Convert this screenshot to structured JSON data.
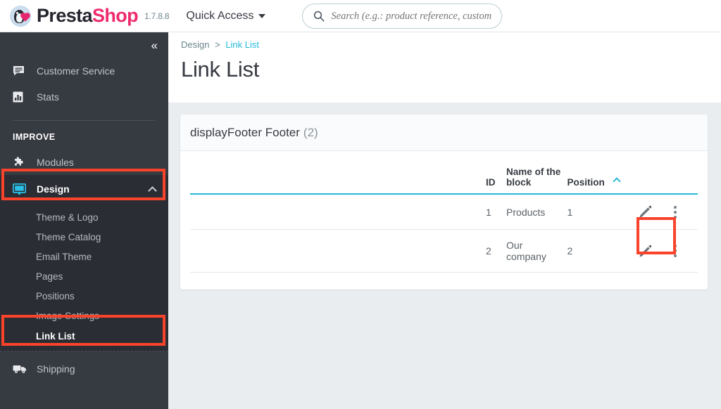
{
  "header": {
    "brand_part1": "Presta",
    "brand_part2": "Shop",
    "version": "1.7.8.8",
    "quick_access_label": "Quick Access",
    "search_placeholder": "Search (e.g.: product reference, custom",
    "search_value": "",
    "logo_icon": "prestashop-logo-icon",
    "search_icon": "search-icon",
    "caret_icon": "chevron-down-icon"
  },
  "sidebar": {
    "collapse_icon": "double-chevron-left-icon",
    "collapse_glyph": "«",
    "top_items": [
      {
        "label": "Customer Service",
        "icon": "comment-icon"
      },
      {
        "label": "Stats",
        "icon": "bar-chart-icon"
      }
    ],
    "section_title": "IMPROVE",
    "items": [
      {
        "label": "Modules",
        "icon": "puzzle-piece-icon"
      },
      {
        "label": "Design",
        "icon": "desktop-icon",
        "active": true,
        "chevron": "chevron-up-icon"
      }
    ],
    "submenu": [
      {
        "label": "Theme & Logo"
      },
      {
        "label": "Theme Catalog"
      },
      {
        "label": "Email Theme"
      },
      {
        "label": "Pages"
      },
      {
        "label": "Positions"
      },
      {
        "label": "Image Settings"
      },
      {
        "label": "Link List",
        "current": true
      }
    ],
    "bottom_items": [
      {
        "label": "Shipping",
        "icon": "truck-icon"
      }
    ]
  },
  "breadcrumb": {
    "parent": "Design",
    "separator": ">",
    "current": "Link List"
  },
  "page": {
    "title": "Link List"
  },
  "card": {
    "title": "displayFooter Footer",
    "count": "(2)"
  },
  "table": {
    "columns": [
      {
        "key": "id",
        "label": "ID"
      },
      {
        "key": "name",
        "label": "Name of the block"
      },
      {
        "key": "position",
        "label": "Position",
        "sorted": "asc",
        "sort_icon": "chevron-up-icon"
      },
      {
        "key": "actions",
        "label": ""
      }
    ],
    "rows": [
      {
        "id": "1",
        "name": "Products",
        "position": "1",
        "edit_icon": "pencil-icon",
        "menu_icon": "kebab-menu-icon",
        "highlighted": true
      },
      {
        "id": "2",
        "name": "Our company",
        "position": "2",
        "edit_icon": "pencil-icon",
        "menu_icon": "kebab-menu-icon",
        "highlighted": false
      }
    ]
  },
  "annotations": {
    "highlight_color": "#f9432b",
    "targets": [
      "sidebar-item-design",
      "sidebar-subitem-link-list",
      "row-1-edit-button"
    ]
  },
  "colors": {
    "accent_teal": "#25b9d7",
    "sidebar_bg": "#363a41",
    "sidebar_active_bg": "#2a2d33",
    "brand_pink": "#ee2b6e",
    "content_bg": "#eaedf0"
  }
}
